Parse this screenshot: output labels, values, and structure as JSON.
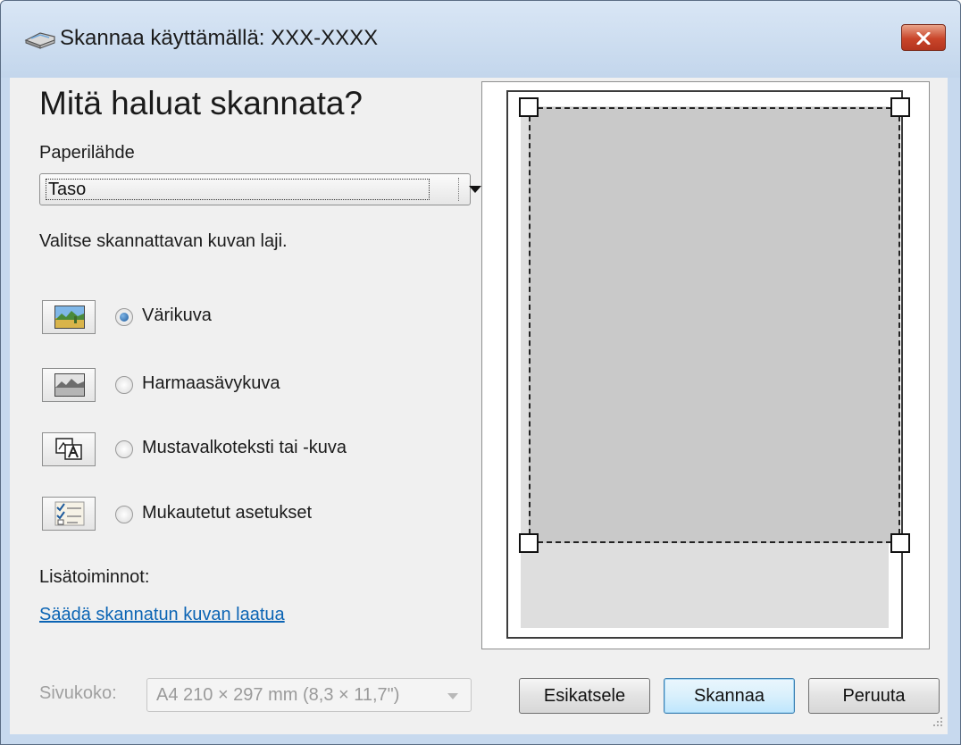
{
  "window": {
    "title": "Skannaa käyttämällä: XXX-XXXX"
  },
  "main": {
    "heading": "Mitä haluat skannata?",
    "paper_source": {
      "label": "Paperilähde",
      "value": "Taso"
    },
    "instruction": "Valitse skannattavan kuvan laji.",
    "image_types": [
      {
        "label": "Värikuva",
        "icon": "color-picture-icon",
        "checked": true
      },
      {
        "label": "Harmaasävykuva",
        "icon": "grayscale-picture-icon",
        "checked": false
      },
      {
        "label": "Mustavalkoteksti tai -kuva",
        "icon": "black-white-text-icon",
        "checked": false
      },
      {
        "label": "Mukautetut asetukset",
        "icon": "custom-settings-icon",
        "checked": false
      }
    ],
    "more_options_label": "Lisätoiminnot:",
    "adjust_quality_link": "Säädä skannatun kuvan laatua",
    "page_size": {
      "label": "Sivukoko:",
      "value": "A4 210 × 297 mm (8,3 × 11,7\")",
      "disabled": true
    }
  },
  "buttons": {
    "preview": "Esikatsele",
    "scan": "Skannaa",
    "cancel": "Peruuta"
  },
  "colors": {
    "link": "#0b64b4",
    "titlebar": "#c7d9ee",
    "close_button": "#c9452a",
    "scan_area": "#c9c9c9"
  }
}
